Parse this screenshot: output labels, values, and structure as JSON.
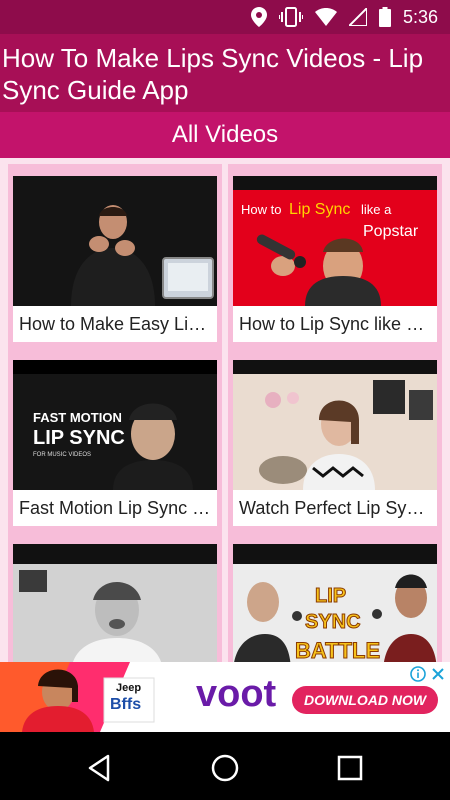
{
  "status": {
    "time": "5:36"
  },
  "app": {
    "title": "How To Make Lips Sync Videos - Lip Sync Guide App"
  },
  "section": {
    "title": "All Videos"
  },
  "videos": [
    {
      "caption": "How to Make Easy Lip Sync Videos",
      "thumb_text": ""
    },
    {
      "caption": "How to Lip Sync like a Popstar",
      "thumb_text": "How to Lip Sync like a Popstar",
      "thumb_parts": [
        "How to",
        "Lip Sync",
        "like a",
        "Popstar"
      ]
    },
    {
      "caption": "Fast Motion Lip Sync for Music Videos",
      "thumb_parts": [
        "FAST MOTION",
        "LIP SYNC",
        "FOR MUSIC VIDEOS"
      ]
    },
    {
      "caption": "Watch Perfect Lip Sync Videos"
    },
    {
      "caption": ""
    },
    {
      "caption": "",
      "thumb_parts": [
        "LIP",
        "SYNC",
        "BATTLE"
      ]
    }
  ],
  "ad": {
    "brand": "voot",
    "cta": "DOWNLOAD NOW",
    "jeep_label": "Jeep",
    "bffs_label": "Bffs",
    "colors": {
      "brand": "#6a1ba8",
      "cta": "#e2245f",
      "banner": "#ff2d6e"
    }
  },
  "nav": {
    "icons": [
      "back-icon",
      "home-icon",
      "recents-icon"
    ]
  }
}
